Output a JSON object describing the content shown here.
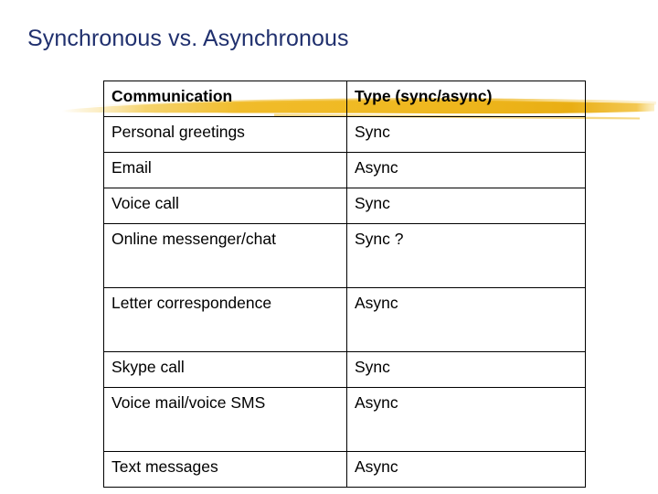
{
  "slide": {
    "title": "Synchronous vs. Asynchronous",
    "title_color": "#20306E",
    "background_color": "#FFFFFF",
    "accent_color": "#EFB81F"
  },
  "table": {
    "headers": [
      "Communication",
      "Type (sync/async)"
    ],
    "rows": [
      {
        "communication": "Personal greetings",
        "type": "Sync",
        "tall": false
      },
      {
        "communication": "Email",
        "type": "Async",
        "tall": false
      },
      {
        "communication": "Voice call",
        "type": "Sync",
        "tall": false
      },
      {
        "communication": "Online messenger/chat",
        "type": "Sync ?",
        "tall": true
      },
      {
        "communication": "Letter correspondence",
        "type": "Async",
        "tall": true
      },
      {
        "communication": "Skype call",
        "type": "Sync",
        "tall": false
      },
      {
        "communication": "Voice mail/voice SMS",
        "type": "Async",
        "tall": true
      },
      {
        "communication": "Text messages",
        "type": "Async",
        "tall": false
      }
    ]
  }
}
